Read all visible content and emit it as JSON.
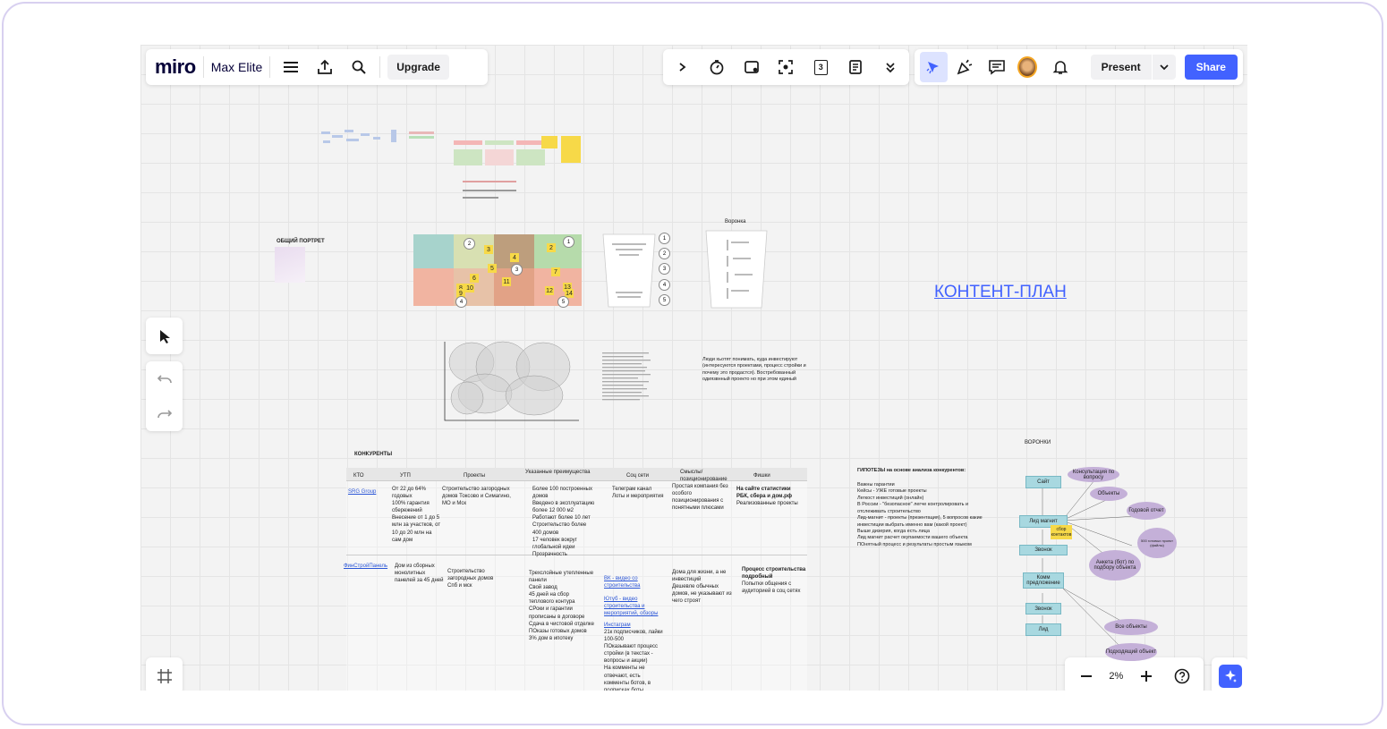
{
  "app": {
    "logo": "miro",
    "board_name": "Max Elite",
    "upgrade_label": "Upgrade"
  },
  "toolbar": {
    "present_label": "Present",
    "share_label": "Share",
    "sticky_count_icon": "3"
  },
  "zoom": {
    "level": "2%"
  },
  "canvas": {
    "content_plan_title": "КОНТЕНТ-ПЛАН",
    "portrait_title": "ОБЩИЙ ПОРТРЕТ",
    "funnel_title": "Воронка",
    "funnels_title": "ВОРОНКИ",
    "competitors_title": "КОНКУРЕНТЫ",
    "people_note": "Люди хьотят понимать, куда инвестируют (интересуются проектами, процесс стройки и почему это продастся). Востребованный одиязвнный проекто но при этом единый",
    "competitors_table": {
      "headers": [
        "КТО",
        "УТП",
        "Проекты",
        "Указанные преимущества",
        "Соц сети",
        "Смыслы/ позиционирование",
        "Фишки"
      ],
      "rows": [
        {
          "who": "SRG Group",
          "utp": "От 22 до 64% годовых\n100% гарантия сбережений\nВнесение от 1 до 5 млн за участков, от 10 до 20 млн на сам дом",
          "projects": "Строительство загородных домов Токсово и Симагино, МО и Мск",
          "advantages": "Более 100 построенных домов\nВведено в эксплуатацию более 12 000 м2\nРаботают более 10 лет\nСтроительство более 400 домов\n17 человек вокруг глобальной идеи\nПрозрачность",
          "social": "Телеграм канал\nЛоты и мероприятия",
          "positioning": "Простая компания без особого позиционирования с понятными плюсами",
          "features_bold": "На сайте статистики РБК, сбера и дом.рф",
          "features": "Реализованные проекты"
        },
        {
          "who": "ФинСтройПанель",
          "utp": "Дом из сборных монолитных панелей за 45 дней",
          "projects": "Строительство загородных домов Спб и мск",
          "advantages": "Трехслойные утепленные панели\nСвой завод\n45 дней на сбор теплового контура\nСРоки и гарантии прописаны в договоре\nСдача в чистовой отделке\nПОказы готовых домов\n3% дом в ипотеку",
          "social_links": [
            "ВК - видео со строительства",
            "Ютуб - видео строительства и мероприятий, обзоры",
            "Инстаграм"
          ],
          "social": "21к подписчиков, лайки 100-500\nПОказывают процесс стройки (в текстах - вопросы и акции)\nНа комменты не отвечают, есть комменты ботов, в подписках боты",
          "positioning": "Дома для жизни, а не инвестиций\nДешевле обычных домов, не указывают из чего строят",
          "features_bold": "Процесс строительства подробный",
          "features": "Попытки общения с аудиторией в соц сетях"
        }
      ]
    },
    "hypotheses": {
      "title": "ГИПОТЕЗЫ на основе анализа конкурентов:",
      "lines": [
        "Важны гарантии",
        "Кейсы - УЖЕ готовые проекты",
        "Легкост инвестиций (онлайн)",
        "В России - \"безопасное\" легче контролировать и отслеживать строительство",
        "Лид-магнит - проекты (презентация), 5 вопросов какие инвестиции выбрать именно вам (какой проект)",
        "Выше дизерия, когда есть лица",
        "Лид магнит расчет окупаемости вашего объекта",
        "ПОнятный процесс и результаты простым языком"
      ]
    },
    "funnel_nodes": [
      "Сайт",
      "Лид магнит",
      "Звонок",
      "Комм предложение",
      "Звонок",
      "Лид"
    ],
    "funnel_ovals": [
      "Консультация по вопросу",
      "Объекты",
      "Годовой отчет",
      "Анкета (бот) по подбору объекта",
      "Все объекты",
      "Подходящий объект",
      "500 готовых проект (файлы)"
    ],
    "funnel_sticky": "сбор контактов",
    "matrix_numbers": [
      "1",
      "2",
      "3",
      "2",
      "4",
      "3",
      "5",
      "6",
      "7",
      "8",
      "9",
      "10",
      "11",
      "12",
      "13",
      "14",
      "15",
      "4",
      "5"
    ],
    "funnel_step_numbers": [
      "1",
      "2",
      "3",
      "4",
      "5"
    ]
  },
  "colors": {
    "accent": "#4262ff",
    "brand_link": "#4262ff",
    "sticky": "#f7d948",
    "node": "#a8d8e0",
    "oval": "#c4b0d8"
  }
}
